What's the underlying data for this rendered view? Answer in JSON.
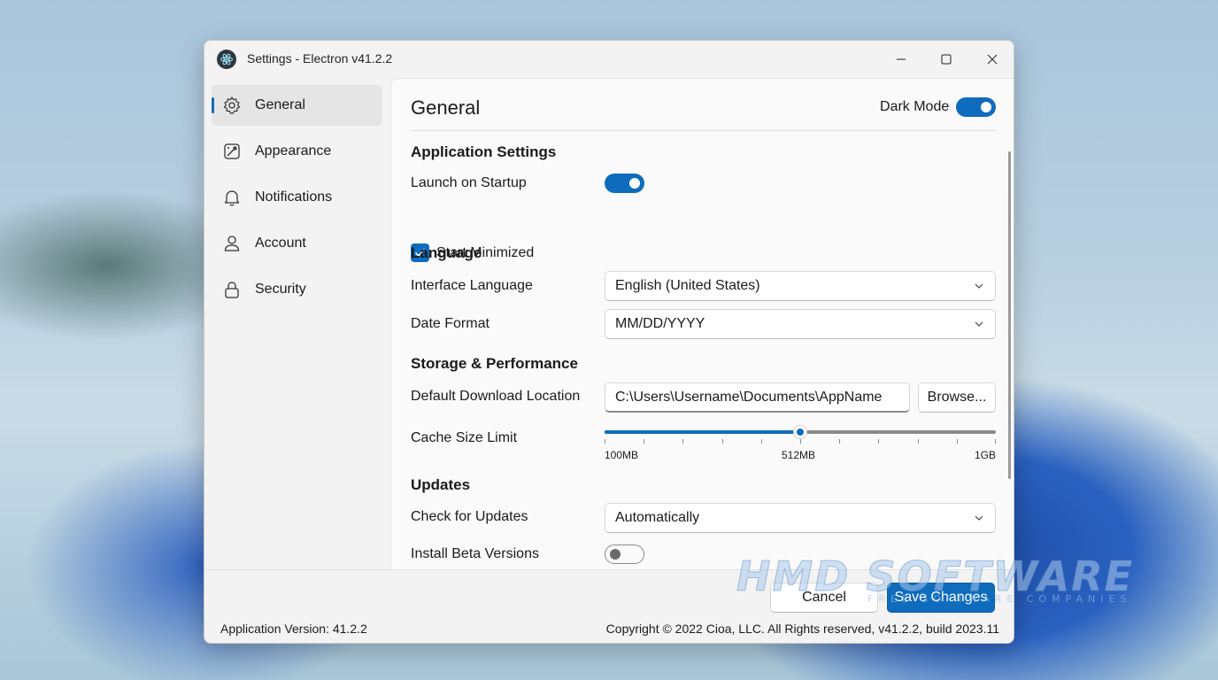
{
  "window": {
    "title": "Settings - Electron v41.2.2"
  },
  "sidebar": {
    "items": [
      {
        "label": "General",
        "icon": "gear-icon",
        "active": true
      },
      {
        "label": "Appearance",
        "icon": "palette-icon",
        "active": false
      },
      {
        "label": "Notifications",
        "icon": "bell-icon",
        "active": false
      },
      {
        "label": "Account",
        "icon": "person-icon",
        "active": false
      },
      {
        "label": "Security",
        "icon": "lock-icon",
        "active": false
      }
    ]
  },
  "header": {
    "title": "General",
    "dark_mode_label": "Dark Mode",
    "dark_mode_on": true
  },
  "sections": {
    "app_settings": "Application Settings",
    "language": "Language",
    "storage": "Storage & Performance",
    "updates": "Updates"
  },
  "settings": {
    "launch_on_startup": {
      "label": "Launch on Startup",
      "on": true
    },
    "start_minimized": {
      "label": "Start Minimized",
      "checked": true
    },
    "interface_language": {
      "label": "Interface Language",
      "value": "English (United States)"
    },
    "date_format": {
      "label": "Date Format",
      "value": "MM/DD/YYYY"
    },
    "download_location": {
      "label": "Default Download Location",
      "value": "C:\\Users\\Username\\Documents\\AppName",
      "browse_label": "Browse..."
    },
    "cache_size": {
      "label": "Cache Size Limit",
      "min_label": "100MB",
      "mid_label": "512MB",
      "max_label": "1GB",
      "position_fraction": 0.5,
      "tick_count": 11
    },
    "check_updates": {
      "label": "Check for Updates",
      "value": "Automatically"
    },
    "beta_versions": {
      "label": "Install Beta Versions",
      "on": false
    }
  },
  "footer": {
    "cancel_label": "Cancel",
    "save_label": "Save Changes",
    "app_version": "Application Version: 41.2.2",
    "copyright": "Copyright © 2022 Cioa, LLC. All Rights reserved, v41.2.2, build 2023.11"
  },
  "watermark": {
    "brand": "HMD SOFTWARE",
    "tagline": "FREE SOFTWARE COMPANIES"
  },
  "colors": {
    "accent": "#0f6cbd",
    "window_bg": "#f3f3f3",
    "content_bg": "#fafafa"
  }
}
